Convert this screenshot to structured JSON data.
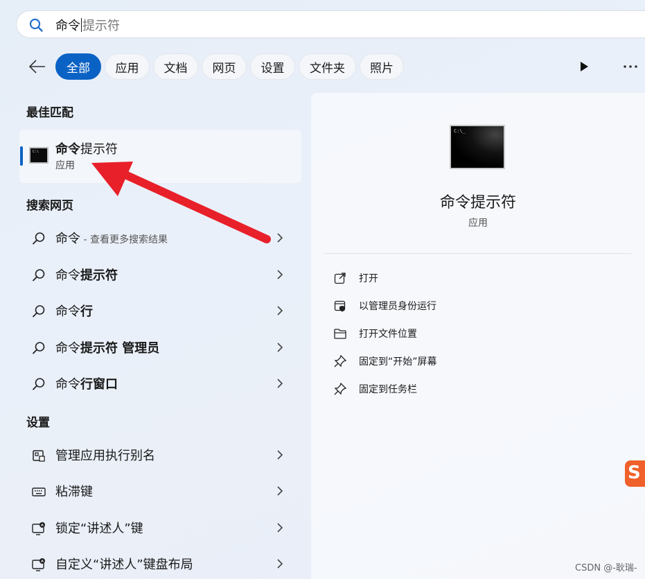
{
  "search": {
    "typed": "命令",
    "suggestion": "提示符"
  },
  "filters": {
    "back_label": "back",
    "chips": [
      "全部",
      "应用",
      "文档",
      "网页",
      "设置",
      "文件夹",
      "照片"
    ]
  },
  "sections": {
    "best_match": "最佳匹配",
    "web": "搜索网页",
    "settings": "设置"
  },
  "best_match": {
    "title_bold": "命令",
    "title_rest": "提示符",
    "subtitle": "应用"
  },
  "web_results": [
    {
      "pre": "命令",
      "bold": "",
      "sub": " - 查看更多搜索结果"
    },
    {
      "pre": "命令",
      "bold": "提示符",
      "sub": ""
    },
    {
      "pre": "命令",
      "bold": "行",
      "sub": ""
    },
    {
      "pre": "命令",
      "bold": "提示符 管理员",
      "sub": ""
    },
    {
      "pre": "命令",
      "bold": "行窗口",
      "sub": ""
    }
  ],
  "settings_results": [
    {
      "label": "管理应用执行别名",
      "icon": "app-alias-icon"
    },
    {
      "label": "粘滞键",
      "icon": "keyboard-icon"
    },
    {
      "label": "锁定“讲述人”键",
      "icon": "narrator-lock-icon"
    },
    {
      "label": "自定义“讲述人”键盘布局",
      "icon": "narrator-keyboard-icon"
    }
  ],
  "detail": {
    "title": "命令提示符",
    "subtitle": "应用",
    "actions": [
      {
        "label": "打开",
        "icon": "open-icon"
      },
      {
        "label": "以管理员身份运行",
        "icon": "run-as-admin-icon"
      },
      {
        "label": "打开文件位置",
        "icon": "folder-icon"
      },
      {
        "label": "固定到“开始”屏幕",
        "icon": "pin-icon"
      },
      {
        "label": "固定到任务栏",
        "icon": "pin-icon"
      }
    ]
  },
  "colors": {
    "accent": "#0a62c4",
    "arrow": "#e8202a",
    "sogou": "#f0602a"
  },
  "sogou_glyph": "S",
  "watermark": "CSDN @-耿瑞-"
}
